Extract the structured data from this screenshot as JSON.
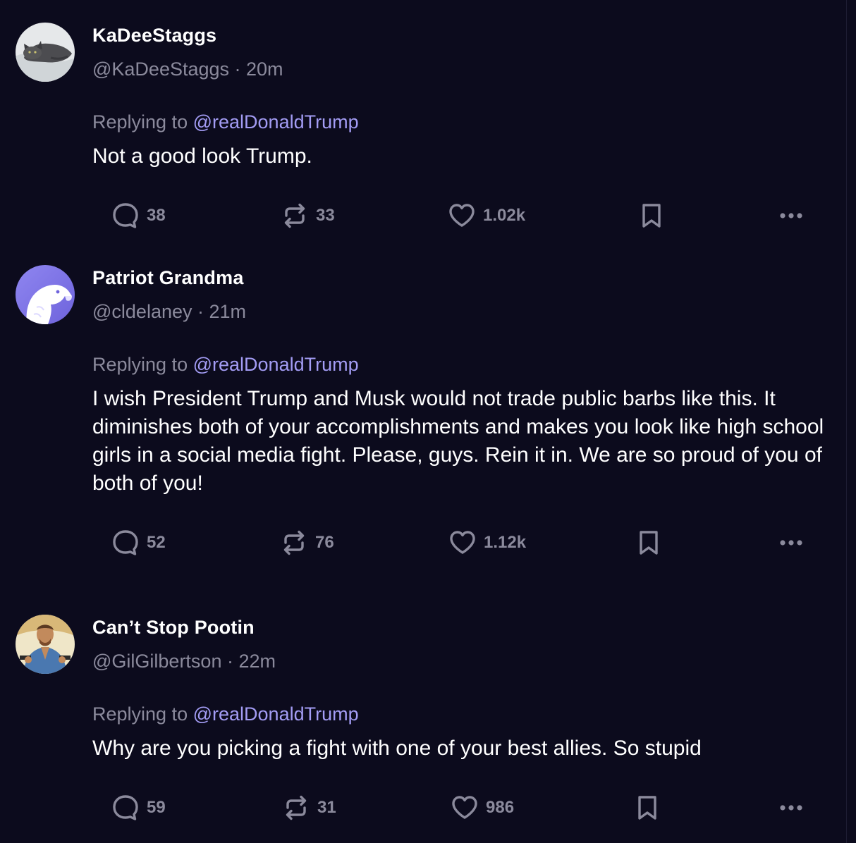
{
  "colors": {
    "background": "#0c0b1d",
    "text_primary": "#ffffff",
    "text_secondary": "#8b8a9c",
    "mention": "#a39cf4",
    "icon": "#8b8a9c"
  },
  "replying_prefix": "Replying to",
  "posts": [
    {
      "display_name": "KaDeeStaggs",
      "meta": "@KaDeeStaggs · 20m",
      "reply_to": "@realDonaldTrump",
      "text": "Not a good look Trump.",
      "replies": "38",
      "reposts": "33",
      "likes": "1.02k",
      "avatar_icon": "cat-photo-avatar"
    },
    {
      "display_name": "Patriot Grandma",
      "meta": "@cldelaney · 21m",
      "reply_to": "@realDonaldTrump",
      "text": "I wish President Trump and Musk would not trade public barbs like this. It diminishes both of your accomplishments and makes you look like high school girls in a social media fight. Please, guys. Rein it in. We are so proud of you of both of you!",
      "replies": "52",
      "reposts": "76",
      "likes": "1.12k",
      "avatar_icon": "eagle-avatar"
    },
    {
      "display_name": "Can’t Stop Pootin",
      "meta": "@GilGilbertson · 22m",
      "reply_to": "@realDonaldTrump",
      "text": "Why are you picking a fight with one of your best allies. So stupid",
      "replies": "59",
      "reposts": "31",
      "likes": "986",
      "avatar_icon": "person-photo-avatar"
    }
  ]
}
